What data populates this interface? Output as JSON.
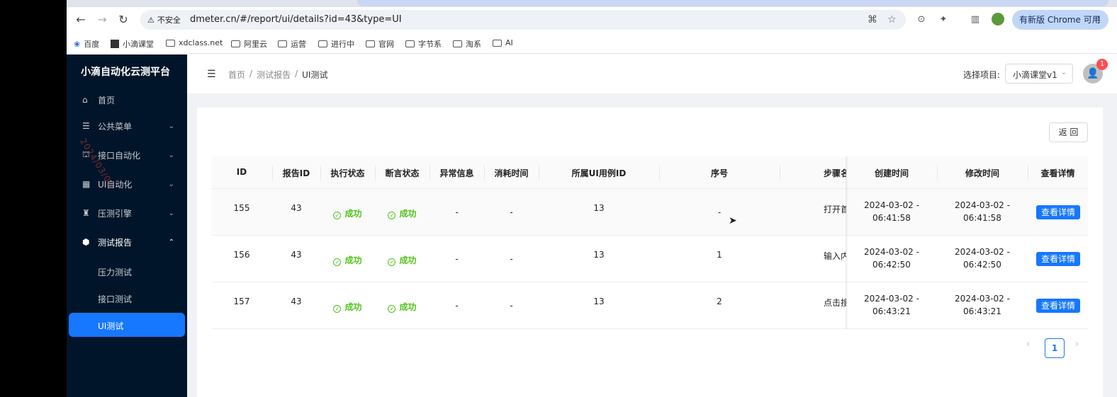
{
  "browser": {
    "security_label": "不安全",
    "url": "dmeter.cn/#/report/ui/details?id=43&type=UI",
    "update_label": "有新版 Chrome 可用",
    "bookmarks": [
      "百度",
      "小滴课堂",
      "xdclass.net",
      "阿里云",
      "运营",
      "进行中",
      "官网",
      "字节系",
      "淘系",
      "AI"
    ]
  },
  "app": {
    "brand": "小滴自动化云测平台",
    "watermark": "2024/03/02",
    "menu": [
      {
        "label": "首页",
        "icon": "home-icon",
        "has_children": false
      },
      {
        "label": "公共菜单",
        "icon": "list-icon",
        "has_children": true
      },
      {
        "label": "接口自动化",
        "icon": "api-icon",
        "has_children": true
      },
      {
        "label": "UI自动化",
        "icon": "grid-icon",
        "has_children": true
      },
      {
        "label": "压测引擎",
        "icon": "cluster-icon",
        "has_children": true
      },
      {
        "label": "测试报告",
        "icon": "cube-icon",
        "has_children": true,
        "open": true
      }
    ],
    "submenu": [
      {
        "label": "压力测试",
        "active": false
      },
      {
        "label": "接口测试",
        "active": false
      },
      {
        "label": "UI测试",
        "active": true
      }
    ]
  },
  "header": {
    "breadcrumb": [
      "首页",
      "测试报告",
      "UI测试"
    ],
    "project_label": "选择项目:",
    "project_value": "小滴课堂v1",
    "notification_count": "1"
  },
  "content": {
    "back_label": "返 回",
    "columns": [
      "ID",
      "报告ID",
      "执行状态",
      "断言状态",
      "异常信息",
      "消耗时间",
      "所属UI用例ID",
      "序号",
      "步骤名",
      "创建时间",
      "修改时间",
      "查看详情"
    ],
    "rows": [
      {
        "id": "155",
        "report_id": "43",
        "exec_status": "成功",
        "assert_status": "成功",
        "exception": "-",
        "elapsed": "-",
        "case_id": "13",
        "seq": "-",
        "step": "打开首",
        "created_date": "2024-03-02 -",
        "created_time": "06:41:58",
        "modified_date": "2024-03-02 -",
        "modified_time": "06:41:58",
        "action": "查看详情"
      },
      {
        "id": "156",
        "report_id": "43",
        "exec_status": "成功",
        "assert_status": "成功",
        "exception": "-",
        "elapsed": "-",
        "case_id": "13",
        "seq": "1",
        "step": "输入内",
        "created_date": "2024-03-02 -",
        "created_time": "06:42:50",
        "modified_date": "2024-03-02 -",
        "modified_time": "06:42:50",
        "action": "查看详情"
      },
      {
        "id": "157",
        "report_id": "43",
        "exec_status": "成功",
        "assert_status": "成功",
        "exception": "-",
        "elapsed": "-",
        "case_id": "13",
        "seq": "2",
        "step": "点击搜",
        "created_date": "2024-03-02 -",
        "created_time": "06:43:21",
        "modified_date": "2024-03-02 -",
        "modified_time": "06:43:21",
        "action": "查看详情"
      }
    ],
    "pagination": {
      "current": "1"
    }
  }
}
